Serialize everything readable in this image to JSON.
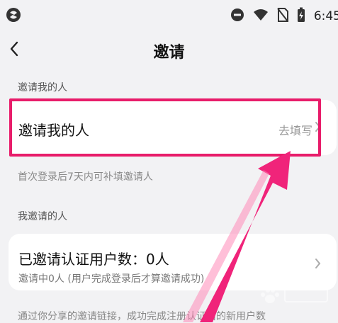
{
  "status_bar": {
    "time": "6:45",
    "icons": [
      "app-logo-icon",
      "dnd-icon",
      "wifi-icon",
      "no-sim-icon",
      "battery-charging-icon"
    ]
  },
  "header": {
    "back_icon": "chevron-left-icon",
    "title": "邀请"
  },
  "section_inviter": {
    "label": "邀请我的人",
    "row_title": "邀请我的人",
    "action": "去填写",
    "hint": "首次登录后7天内可补填邀请人"
  },
  "section_invited": {
    "label": "我邀请的人",
    "count_text": "已邀请认证用户数：0人",
    "sub_text": "邀请中0人 (用户完成登录后才算邀请成功)"
  },
  "footer_hint": "通过你分享的邀请链接，成功完成注册认证后的新用户数",
  "annotation": {
    "highlight_color": "#e81c6a",
    "arrow_color": "#f0247a"
  }
}
